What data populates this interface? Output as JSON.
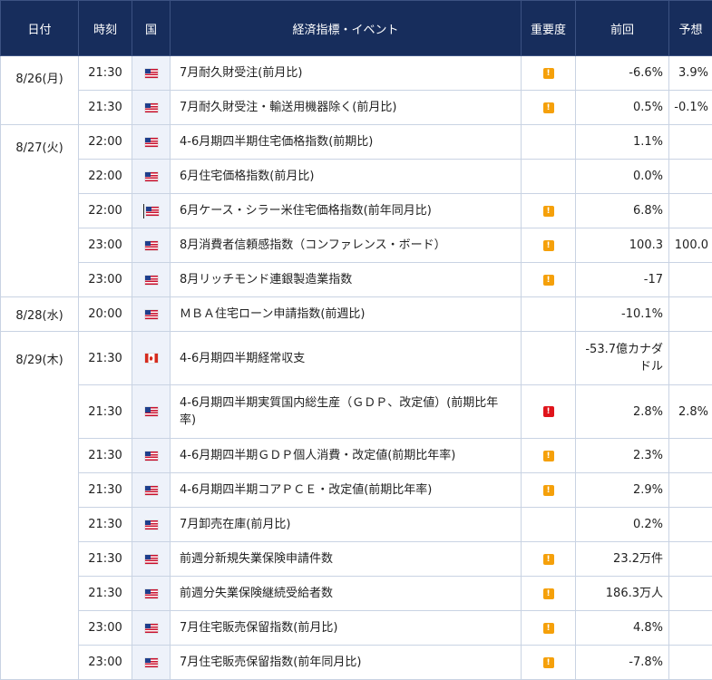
{
  "header": {
    "date": "日付",
    "time": "時刻",
    "country": "国",
    "event": "経済指標・イベント",
    "importance": "重要度",
    "previous": "前回",
    "forecast": "予想"
  },
  "colors": {
    "header_bg": "#172d5c",
    "importance_medium": "#f5a00a",
    "importance_high": "#e0141b"
  },
  "rows": [
    {
      "date": "8/26(月)",
      "time": "21:30",
      "country": "us-flag-icon",
      "event": "7月耐久財受注(前月比)",
      "importance": "medium",
      "importance_mark": "!",
      "previous": "-6.6%",
      "forecast": "3.9%"
    },
    {
      "date": "",
      "time": "21:30",
      "country": "us-flag-icon",
      "event": "7月耐久財受注・輸送用機器除く(前月比)",
      "importance": "medium",
      "importance_mark": "!",
      "previous": "0.5%",
      "forecast": "-0.1%"
    },
    {
      "date": "8/27(火)",
      "time": "22:00",
      "country": "us-flag-icon",
      "event": "4-6月期四半期住宅価格指数(前期比)",
      "importance": "",
      "importance_mark": "",
      "previous": "1.1%",
      "forecast": ""
    },
    {
      "date": "",
      "time": "22:00",
      "country": "us-flag-icon",
      "event": "6月住宅価格指数(前月比)",
      "importance": "",
      "importance_mark": "",
      "previous": "0.0%",
      "forecast": ""
    },
    {
      "date": "",
      "time": "22:00",
      "country": "us-flag-icon",
      "event": "6月ケース・シラー米住宅価格指数(前年同月比)",
      "importance": "medium",
      "importance_mark": "!",
      "previous": "6.8%",
      "forecast": ""
    },
    {
      "date": "",
      "time": "23:00",
      "country": "us-flag-icon",
      "event": "8月消費者信頼感指数（コンファレンス・ボード）",
      "importance": "medium",
      "importance_mark": "!",
      "previous": "100.3",
      "forecast": "100.0"
    },
    {
      "date": "",
      "time": "23:00",
      "country": "us-flag-icon",
      "event": "8月リッチモンド連銀製造業指数",
      "importance": "medium",
      "importance_mark": "!",
      "previous": "-17",
      "forecast": ""
    },
    {
      "date": "8/28(水)",
      "time": "20:00",
      "country": "us-flag-icon",
      "event": "ＭＢＡ住宅ローン申請指数(前週比)",
      "importance": "",
      "importance_mark": "",
      "previous": "-10.1%",
      "forecast": ""
    },
    {
      "date": "8/29(木)",
      "time": "21:30",
      "country": "ca-flag-icon",
      "event": "4-6月期四半期経常収支",
      "importance": "",
      "importance_mark": "",
      "previous": "-53.7億カナダドル",
      "forecast": ""
    },
    {
      "date": "",
      "time": "21:30",
      "country": "us-flag-icon",
      "event": "4-6月期四半期実質国内総生産（ＧＤＰ、改定値）(前期比年率)",
      "importance": "high",
      "importance_mark": "!",
      "previous": "2.8%",
      "forecast": "2.8%"
    },
    {
      "date": "",
      "time": "21:30",
      "country": "us-flag-icon",
      "event": "4-6月期四半期ＧＤＰ個人消費・改定値(前期比年率)",
      "importance": "medium",
      "importance_mark": "!",
      "previous": "2.3%",
      "forecast": ""
    },
    {
      "date": "",
      "time": "21:30",
      "country": "us-flag-icon",
      "event": "4-6月期四半期コアＰＣＥ・改定値(前期比年率)",
      "importance": "medium",
      "importance_mark": "!",
      "previous": "2.9%",
      "forecast": ""
    },
    {
      "date": "",
      "time": "21:30",
      "country": "us-flag-icon",
      "event": "7月卸売在庫(前月比)",
      "importance": "",
      "importance_mark": "",
      "previous": "0.2%",
      "forecast": ""
    },
    {
      "date": "",
      "time": "21:30",
      "country": "us-flag-icon",
      "event": "前週分新規失業保険申請件数",
      "importance": "medium",
      "importance_mark": "!",
      "previous": "23.2万件",
      "forecast": ""
    },
    {
      "date": "",
      "time": "21:30",
      "country": "us-flag-icon",
      "event": "前週分失業保険継続受給者数",
      "importance": "medium",
      "importance_mark": "!",
      "previous": "186.3万人",
      "forecast": ""
    },
    {
      "date": "",
      "time": "23:00",
      "country": "us-flag-icon",
      "event": "7月住宅販売保留指数(前月比)",
      "importance": "medium",
      "importance_mark": "!",
      "previous": "4.8%",
      "forecast": ""
    },
    {
      "date": "",
      "time": "23:00",
      "country": "us-flag-icon",
      "event": "7月住宅販売保留指数(前年同月比)",
      "importance": "medium",
      "importance_mark": "!",
      "previous": "-7.8%",
      "forecast": ""
    }
  ]
}
